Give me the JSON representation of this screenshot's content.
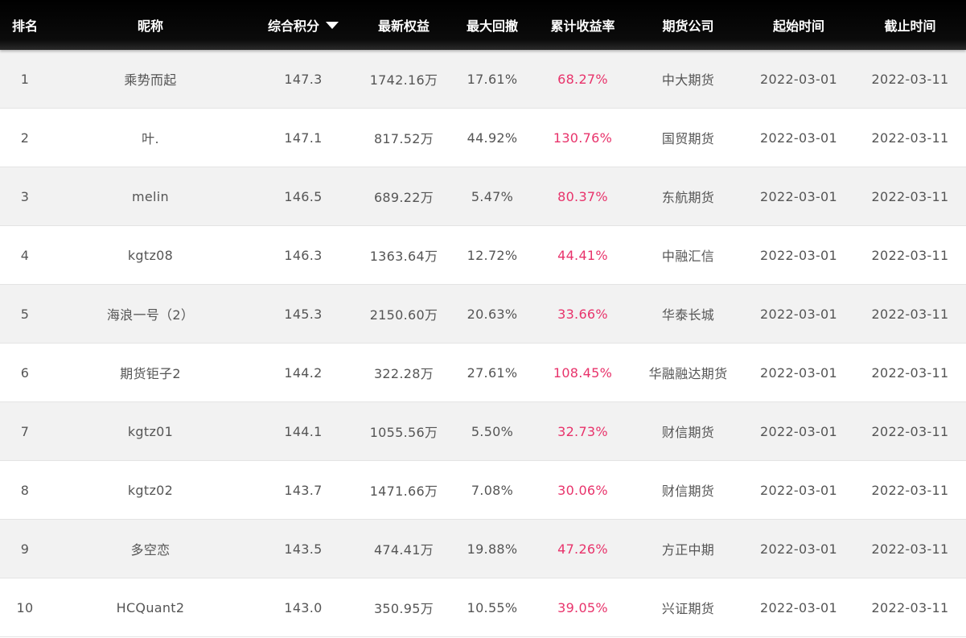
{
  "header": {
    "rank": "排名",
    "nickname": "昵称",
    "score": "综合积分",
    "score_sort_icon": "sort-desc-icon",
    "equity": "最新权益",
    "drawdown": "最大回撤",
    "return": "累计收益率",
    "company": "期货公司",
    "start": "起始时间",
    "end": "截止时间"
  },
  "colors": {
    "header_bg": "#000000",
    "row_alt_bg": "#f2f2f2",
    "return_text": "#e8336b",
    "body_text": "#555555"
  },
  "rows": [
    {
      "rank": "1",
      "nickname": "乘势而起",
      "score": "147.3",
      "equity": "1742.16万",
      "drawdown": "17.61%",
      "return": "68.27%",
      "company": "中大期货",
      "start": "2022-03-01",
      "end": "2022-03-11"
    },
    {
      "rank": "2",
      "nickname": "叶.",
      "score": "147.1",
      "equity": "817.52万",
      "drawdown": "44.92%",
      "return": "130.76%",
      "company": "国贸期货",
      "start": "2022-03-01",
      "end": "2022-03-11"
    },
    {
      "rank": "3",
      "nickname": "melin",
      "score": "146.5",
      "equity": "689.22万",
      "drawdown": "5.47%",
      "return": "80.37%",
      "company": "东航期货",
      "start": "2022-03-01",
      "end": "2022-03-11"
    },
    {
      "rank": "4",
      "nickname": "kgtz08",
      "score": "146.3",
      "equity": "1363.64万",
      "drawdown": "12.72%",
      "return": "44.41%",
      "company": "中融汇信",
      "start": "2022-03-01",
      "end": "2022-03-11"
    },
    {
      "rank": "5",
      "nickname": "海浪一号（2）",
      "score": "145.3",
      "equity": "2150.60万",
      "drawdown": "20.63%",
      "return": "33.66%",
      "company": "华泰长城",
      "start": "2022-03-01",
      "end": "2022-03-11"
    },
    {
      "rank": "6",
      "nickname": "期货钜子2",
      "score": "144.2",
      "equity": "322.28万",
      "drawdown": "27.61%",
      "return": "108.45%",
      "company": "华融融达期货",
      "start": "2022-03-01",
      "end": "2022-03-11"
    },
    {
      "rank": "7",
      "nickname": "kgtz01",
      "score": "144.1",
      "equity": "1055.56万",
      "drawdown": "5.50%",
      "return": "32.73%",
      "company": "财信期货",
      "start": "2022-03-01",
      "end": "2022-03-11"
    },
    {
      "rank": "8",
      "nickname": "kgtz02",
      "score": "143.7",
      "equity": "1471.66万",
      "drawdown": "7.08%",
      "return": "30.06%",
      "company": "财信期货",
      "start": "2022-03-01",
      "end": "2022-03-11"
    },
    {
      "rank": "9",
      "nickname": "多空恋",
      "score": "143.5",
      "equity": "474.41万",
      "drawdown": "19.88%",
      "return": "47.26%",
      "company": "方正中期",
      "start": "2022-03-01",
      "end": "2022-03-11"
    },
    {
      "rank": "10",
      "nickname": "HCQuant2",
      "score": "143.0",
      "equity": "350.95万",
      "drawdown": "10.55%",
      "return": "39.05%",
      "company": "兴证期货",
      "start": "2022-03-01",
      "end": "2022-03-11"
    }
  ]
}
